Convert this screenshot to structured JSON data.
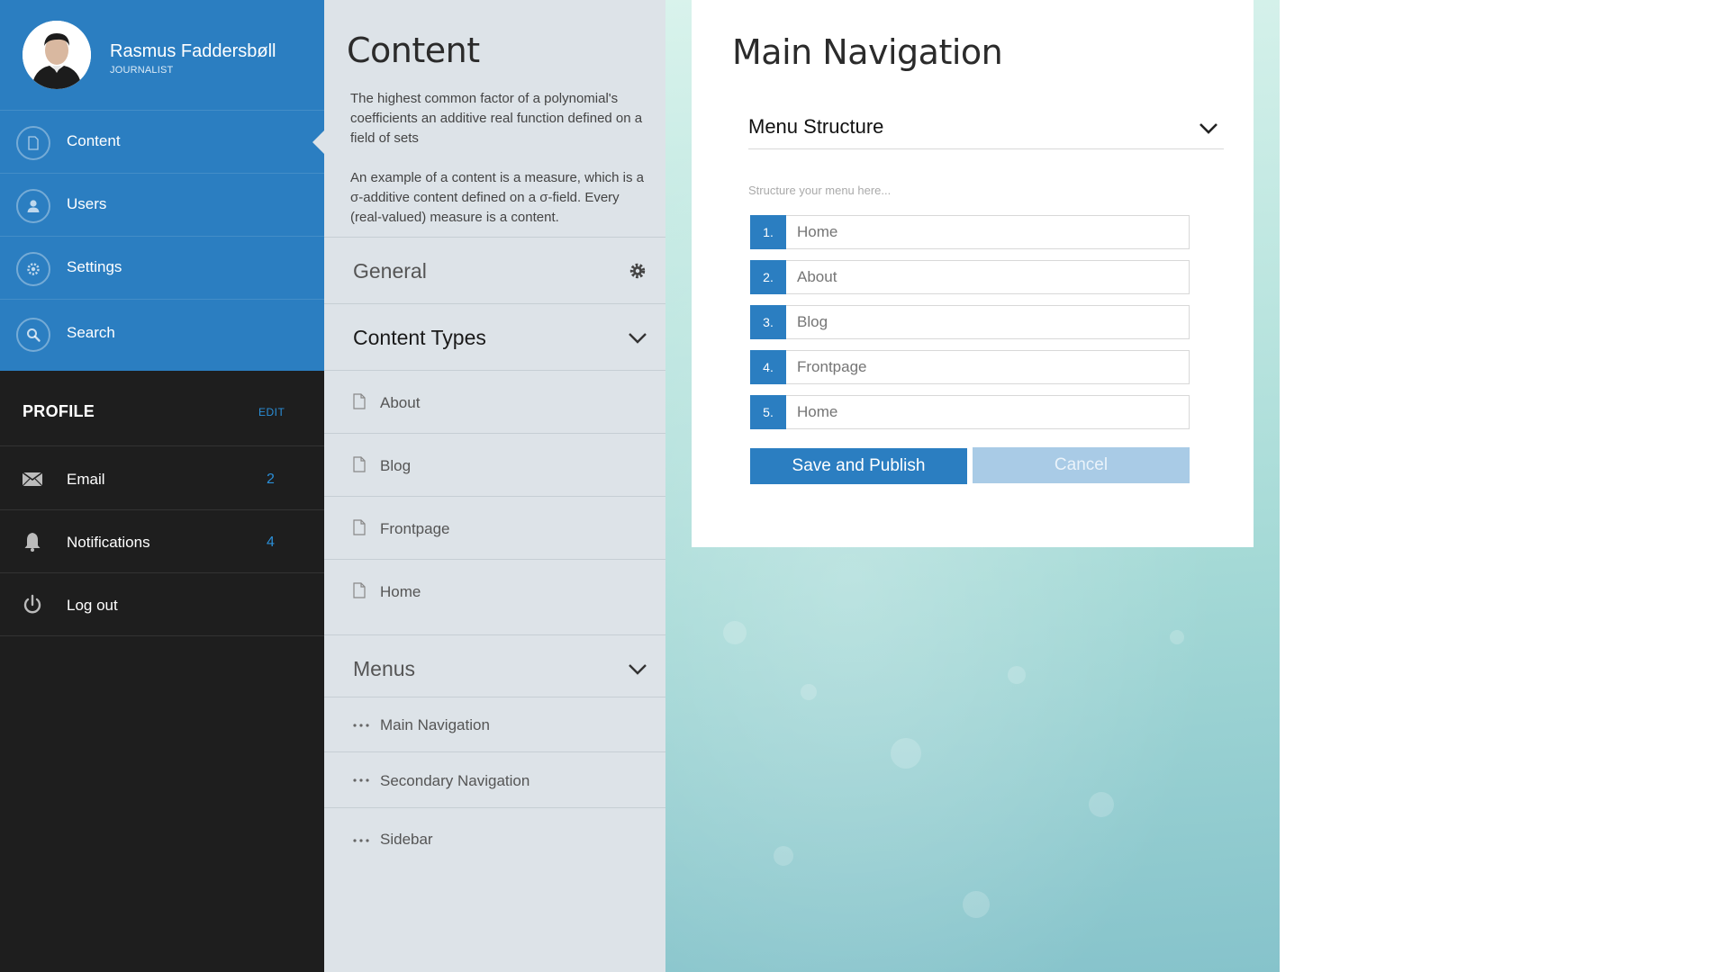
{
  "user": {
    "name": "Rasmus Faddersbøll",
    "role": "JOURNALIST"
  },
  "nav": {
    "items": [
      {
        "label": "Content",
        "icon": "document-icon",
        "active": true
      },
      {
        "label": "Users",
        "icon": "user-icon"
      },
      {
        "label": "Settings",
        "icon": "gear-icon"
      },
      {
        "label": "Search",
        "icon": "search-icon"
      }
    ]
  },
  "profile": {
    "title": "PROFILE",
    "edit_label": "EDIT",
    "items": [
      {
        "label": "Email",
        "count": "2",
        "icon": "envelope-icon"
      },
      {
        "label": "Notifications",
        "count": "4",
        "icon": "bell-icon"
      },
      {
        "label": "Log out",
        "icon": "power-icon"
      }
    ]
  },
  "content": {
    "title": "Content",
    "desc1": "The highest common factor of a polynomial's coefficients an additive real function defined on a field of sets",
    "desc2": "An example of a content is a measure, which is a σ-additive content defined on a σ-field. Every (real-valued) measure is a content.",
    "general_label": "General",
    "content_types_label": "Content Types",
    "content_types": [
      "About",
      "Blog",
      "Frontpage",
      "Home"
    ],
    "menus_label": "Menus",
    "menus": [
      "Main Navigation",
      "Secondary Navigation",
      "Sidebar"
    ]
  },
  "card": {
    "title": "Main Navigation",
    "select_label": "Menu Structure",
    "hint": "Structure your menu here...",
    "rows": [
      {
        "num": "1.",
        "placeholder": "Home"
      },
      {
        "num": "2.",
        "placeholder": "About"
      },
      {
        "num": "3.",
        "placeholder": "Blog"
      },
      {
        "num": "4.",
        "placeholder": "Frontpage"
      },
      {
        "num": "5.",
        "placeholder": "Home"
      }
    ],
    "save_label": "Save and Publish",
    "cancel_label": "Cancel"
  },
  "colors": {
    "accent": "#2b7ec1",
    "sidebar_dark": "#1e1e1e",
    "content_bg": "#dde3e8",
    "count_blue": "#2b8fd8"
  }
}
